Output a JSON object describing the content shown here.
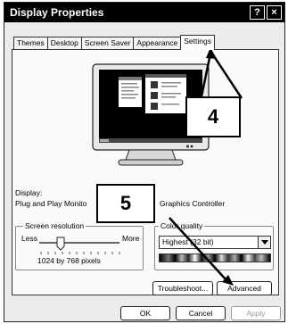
{
  "window": {
    "title": "Display Properties",
    "help_glyph": "?",
    "close_glyph": "×"
  },
  "tabs": [
    {
      "label": "Themes"
    },
    {
      "label": "Desktop"
    },
    {
      "label": "Screen Saver"
    },
    {
      "label": "Appearance"
    },
    {
      "label": "Settings",
      "active": true
    }
  ],
  "display": {
    "label": "Display:",
    "device": "Plug and Play Monito",
    "device_suffix": "Graphics Controller"
  },
  "resolution": {
    "legend": "Screen resolution",
    "less": "Less",
    "more": "More",
    "value": "1024 by 768 pixels",
    "level": 0.25
  },
  "color_quality": {
    "legend": "Color quality",
    "selected": "Highest (32 bit)"
  },
  "buttons": {
    "troubleshoot": "Troubleshoot...",
    "advanced": "Advanced",
    "ok": "OK",
    "cancel": "Cancel",
    "apply": "Apply"
  },
  "callouts": {
    "step4": "4",
    "step5": "5"
  },
  "icons": {
    "monitor": "monitor-preview-icon",
    "dropdown": "chevron-down-icon",
    "slider": "slider-thumb-icon"
  }
}
